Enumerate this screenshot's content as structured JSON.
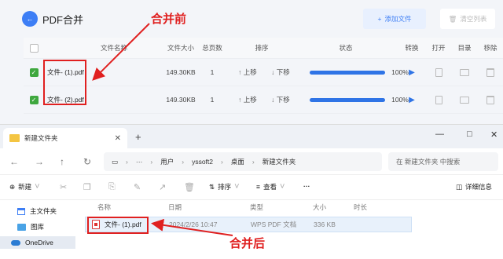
{
  "app": {
    "title": "PDF合并",
    "add_label": "添加文件",
    "clear_label": "清空列表",
    "columns": [
      "文件名称",
      "文件大小",
      "总页数",
      "排序",
      "状态",
      "转换",
      "打开",
      "目录",
      "移除"
    ],
    "up_label": "上移",
    "down_label": "下移",
    "rows": [
      {
        "name": "文件- (1).pdf",
        "size": "149.30KB",
        "pages": "1",
        "progress_text": "100%",
        "progress": 1.0,
        "checked": true
      },
      {
        "name": "文件- (2).pdf",
        "size": "149.30KB",
        "pages": "1",
        "progress_text": "100%",
        "progress": 1.0,
        "checked": true
      }
    ]
  },
  "annotations": {
    "before": "合并前",
    "after": "合并后",
    "color": "#e02020"
  },
  "explorer": {
    "tab_title": "新建文件夹",
    "path": [
      "用户",
      "yssoft2",
      "桌面",
      "新建文件夹"
    ],
    "search_placeholder": "在 新建文件夹 中搜索",
    "new_label": "新建",
    "sort_label": "排序",
    "view_label": "查看",
    "more_label": "···",
    "details_label": "详细信息",
    "nav_items": [
      "主文件夹",
      "图库",
      "OneDrive"
    ],
    "columns": [
      "名称",
      "日期",
      "类型",
      "大小",
      "时长"
    ],
    "file": {
      "name": "文件- (1).pdf",
      "date": "2024/2/26 10:47",
      "type": "WPS PDF 文档",
      "size": "336 KB"
    }
  },
  "colors": {
    "accent": "#3d7ef5",
    "progress": "#2f74e6",
    "check": "#3fa83f"
  }
}
